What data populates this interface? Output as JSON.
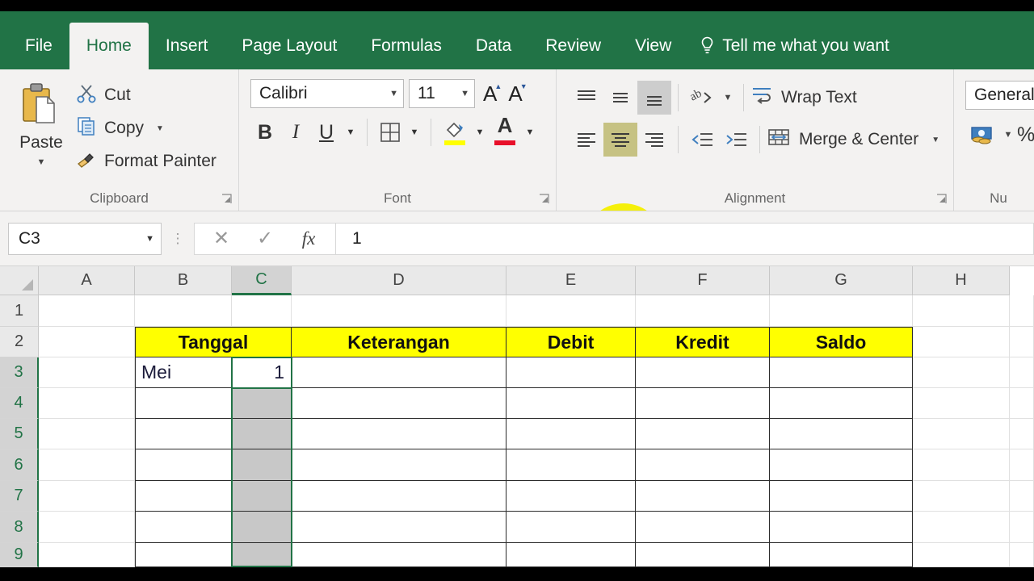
{
  "app": {
    "accent_green": "#217346",
    "highlight_yellow": "#ffff00",
    "cursor_hotspot_color": "#f5f00a"
  },
  "tabs": [
    {
      "label": "File",
      "active": false
    },
    {
      "label": "Home",
      "active": true
    },
    {
      "label": "Insert",
      "active": false
    },
    {
      "label": "Page Layout",
      "active": false
    },
    {
      "label": "Formulas",
      "active": false
    },
    {
      "label": "Data",
      "active": false
    },
    {
      "label": "Review",
      "active": false
    },
    {
      "label": "View",
      "active": false
    }
  ],
  "tellme": {
    "label": "Tell me what you want",
    "icon": "lightbulb-icon"
  },
  "ribbon": {
    "clipboard": {
      "title": "Clipboard",
      "paste_label": "Paste",
      "items": [
        {
          "label": "Cut",
          "icon": "scissors-icon"
        },
        {
          "label": "Copy",
          "icon": "copy-icon"
        },
        {
          "label": "Format Painter",
          "icon": "paintbrush-icon"
        }
      ]
    },
    "font": {
      "title": "Font",
      "font_name": "Calibri",
      "font_size": "11",
      "grow_label": "A",
      "shrink_label": "A",
      "bold_label": "B",
      "italic_label": "I",
      "underline_label": "U",
      "fill_color": "#ffff00",
      "font_color": "#e8102a"
    },
    "alignment": {
      "title": "Alignment",
      "wrap_text_label": "Wrap Text",
      "merge_center_label": "Merge & Center"
    },
    "number": {
      "title": "Nu",
      "format": "General",
      "percent_label": "%"
    }
  },
  "formula_bar": {
    "name_box": "C3",
    "formula_value": "1",
    "cancel_icon": "close-icon",
    "confirm_icon": "check-icon",
    "function_icon": "fx-icon"
  },
  "sheet": {
    "columns": [
      "A",
      "B",
      "C",
      "D",
      "E",
      "F",
      "G",
      "H"
    ],
    "selected_column": "C",
    "rows": [
      "1",
      "2",
      "3",
      "4",
      "5",
      "6",
      "7",
      "8",
      "9"
    ],
    "selected_rows": [
      "3",
      "4",
      "5",
      "6",
      "7",
      "8",
      "9"
    ],
    "table": {
      "headers": [
        "Tanggal",
        "Keterangan",
        "Debit",
        "Kredit",
        "Saldo"
      ],
      "row3": {
        "b": "Mei",
        "c": "1",
        "d": "",
        "e": "",
        "f": "",
        "g": ""
      }
    }
  }
}
